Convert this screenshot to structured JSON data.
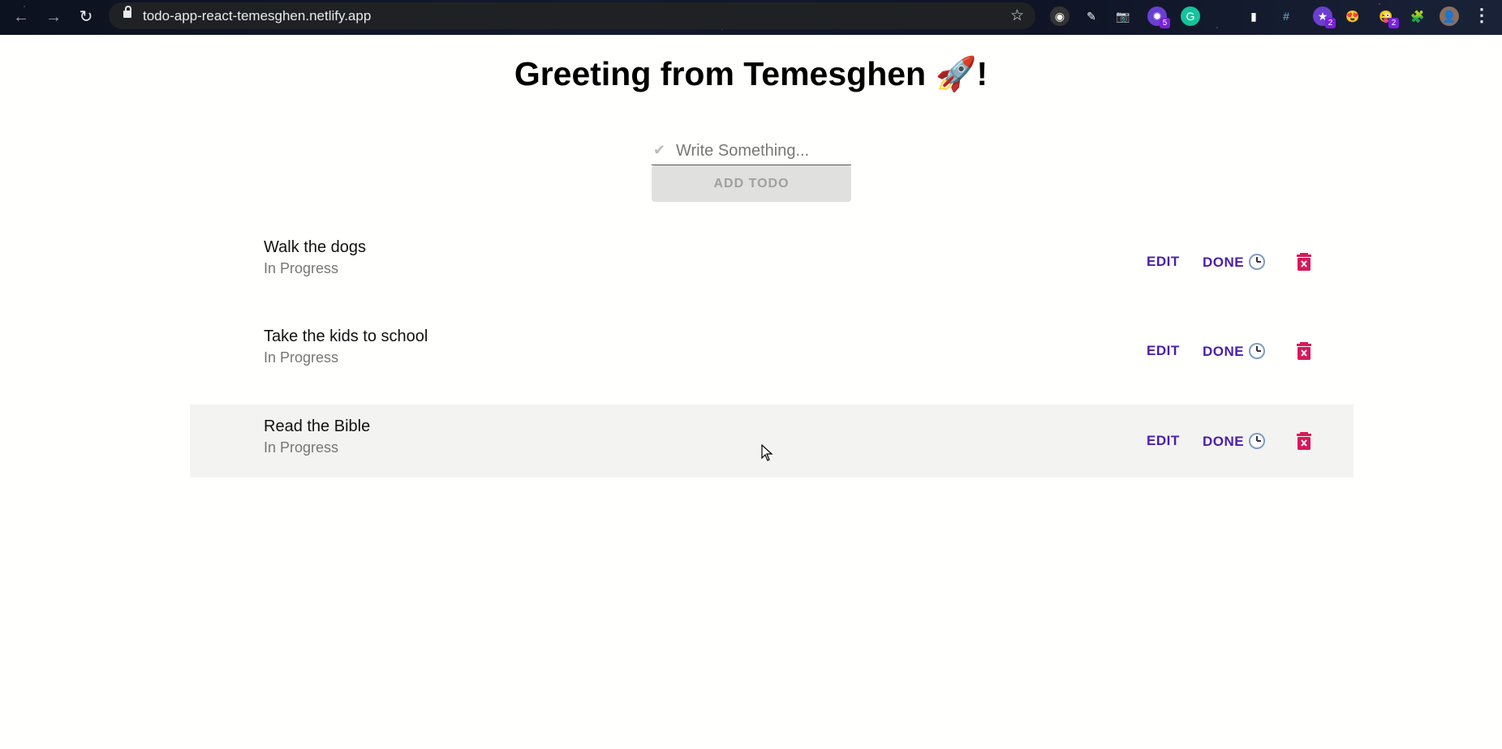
{
  "browser": {
    "url": "todo-app-react-temesghen.netlify.app",
    "extension_badges": [
      "5",
      "2",
      "2"
    ]
  },
  "page": {
    "title": "Greeting from Temesghen 🚀!",
    "input": {
      "placeholder": "Write Something...",
      "value": ""
    },
    "add_button_label": "ADD TODO"
  },
  "todos": [
    {
      "title": "Walk the dogs",
      "status": "In Progress",
      "edit_label": "EDIT",
      "done_label": "DONE"
    },
    {
      "title": "Take the kids to school",
      "status": "In Progress",
      "edit_label": "EDIT",
      "done_label": "DONE"
    },
    {
      "title": "Read the Bible",
      "status": "In Progress",
      "edit_label": "EDIT",
      "done_label": "DONE"
    }
  ],
  "colors": {
    "action_purple": "#4a1fa8",
    "delete_pink": "#d6195c",
    "row_highlight": "#f3f3f1",
    "button_disabled": "#e0e0de"
  }
}
